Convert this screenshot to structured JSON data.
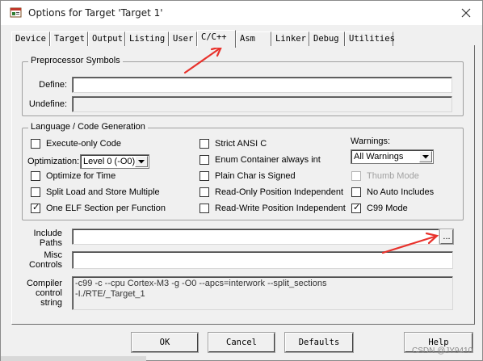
{
  "window": {
    "title": "Options for Target 'Target 1'"
  },
  "tabs": [
    {
      "label": "Device"
    },
    {
      "label": "Target"
    },
    {
      "label": "Output"
    },
    {
      "label": "Listing"
    },
    {
      "label": "User"
    },
    {
      "label": "C/C++",
      "active": true
    },
    {
      "label": "Asm"
    },
    {
      "label": "Linker"
    },
    {
      "label": "Debug"
    },
    {
      "label": "Utilities"
    }
  ],
  "preprocessor": {
    "group_label": "Preprocessor Symbols",
    "define_label": "Define:",
    "define_value": "",
    "undefine_label": "Undefine:",
    "undefine_value": ""
  },
  "language": {
    "group_label": "Language / Code Generation",
    "execute_only": {
      "label": "Execute-only Code",
      "checked": false
    },
    "optimization_label": "Optimization:",
    "optimization_value": "Level 0 (-O0)",
    "optimize_time": {
      "label": "Optimize for Time",
      "checked": false
    },
    "split_load": {
      "label": "Split Load and Store Multiple",
      "checked": false
    },
    "one_elf": {
      "label": "One ELF Section per Function",
      "checked": true
    },
    "strict_ansi": {
      "label": "Strict ANSI C",
      "checked": false
    },
    "enum_container": {
      "label": "Enum Container always int",
      "checked": false
    },
    "plain_char": {
      "label": "Plain Char is Signed",
      "checked": false
    },
    "ro_pi": {
      "label": "Read-Only Position Independent",
      "checked": false
    },
    "rw_pi": {
      "label": "Read-Write Position Independent",
      "checked": false
    },
    "warnings_label": "Warnings:",
    "warnings_value": "All Warnings",
    "thumb_mode": {
      "label": "Thumb Mode",
      "checked": false,
      "disabled": true
    },
    "no_auto_includes": {
      "label": "No Auto Includes",
      "checked": false
    },
    "c99_mode": {
      "label": "C99 Mode",
      "checked": true
    }
  },
  "include_paths": {
    "label": "Include\nPaths",
    "value": "",
    "browse_label": "..."
  },
  "misc_controls": {
    "label": "Misc\nControls",
    "value": ""
  },
  "compiler_control": {
    "label": "Compiler\ncontrol\nstring",
    "line1": "-c99 -c --cpu Cortex-M3 -g -O0 --apcs=interwork --split_sections",
    "line2": "-I./RTE/_Target_1"
  },
  "buttons": {
    "ok": "OK",
    "cancel": "Cancel",
    "defaults": "Defaults",
    "help": "Help"
  },
  "watermark": "CSDN @JY9410",
  "colors": {
    "annotation_arrow": "#e8322c",
    "dialog_bg": "#f0f0f0",
    "window_bg": "#ffffff"
  },
  "icons": {
    "app": "keil-options-icon",
    "close": "close-icon",
    "dropdown": "chevron-down-icon",
    "check": "check-mark-icon"
  }
}
